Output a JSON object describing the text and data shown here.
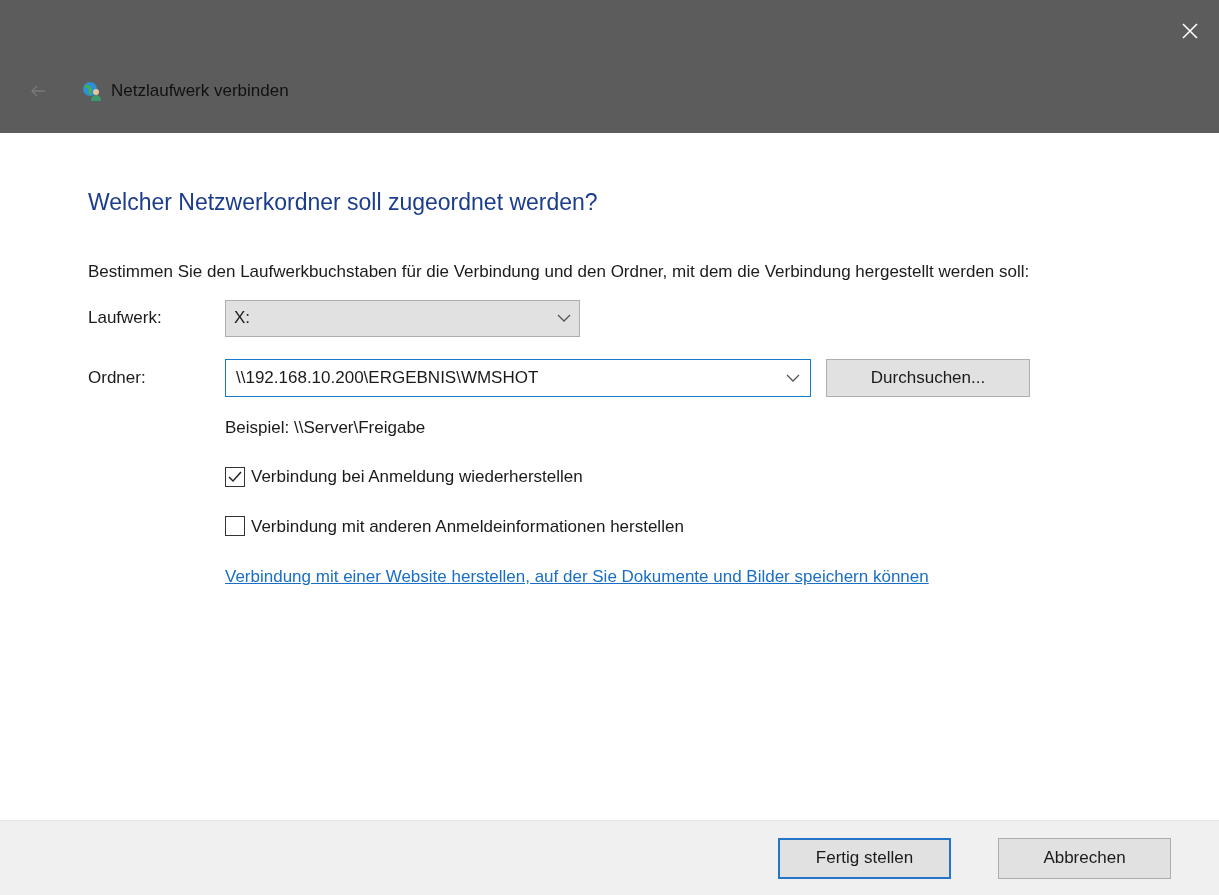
{
  "window": {
    "title": "Netzlaufwerk verbinden"
  },
  "heading": "Welcher Netzwerkordner soll zugeordnet werden?",
  "instruction": "Bestimmen Sie den Laufwerkbuchstaben für die Verbindung und den Ordner, mit dem die Verbindung hergestellt werden soll:",
  "drive": {
    "label": "Laufwerk:",
    "value": "X:"
  },
  "folder": {
    "label": "Ordner:",
    "value": "\\\\192.168.10.200\\ERGEBNIS\\WMSHOT",
    "browse": "Durchsuchen..."
  },
  "example": "Beispiel: \\\\Server\\Freigabe",
  "options": [
    {
      "label": "Verbindung bei Anmeldung wiederherstellen",
      "checked": true
    },
    {
      "label": "Verbindung mit anderen Anmeldeinformationen herstellen",
      "checked": false
    }
  ],
  "link": "Verbindung mit einer Website herstellen, auf der Sie Dokumente und Bilder speichern können",
  "buttons": [
    {
      "label": "Fertig stellen",
      "selected": true
    },
    {
      "label": "Abbrechen",
      "selected": false
    }
  ]
}
